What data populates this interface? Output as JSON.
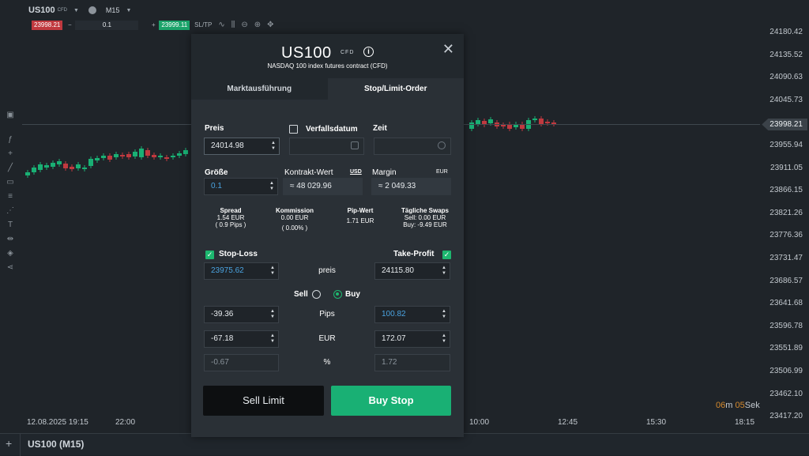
{
  "toolbar": {
    "symbol": "US100",
    "symbol_badge": "CFD",
    "timeframe": "M15",
    "sell_price": "23998.21",
    "quantity": "0.1",
    "buy_price": "23999.11",
    "sltp_label": "SL/TP"
  },
  "y_axis": [
    "24180.42",
    "24135.52",
    "24090.63",
    "24045.73",
    "23955.94",
    "23911.05",
    "23866.15",
    "23821.26",
    "23776.36",
    "23731.47",
    "23686.57",
    "23641.68",
    "23596.78",
    "23551.89",
    "23506.99",
    "23462.10",
    "23417.20"
  ],
  "current_price": "23998.21",
  "x_axis": [
    "12.08.2025 19:15",
    "22:00",
    "10:00",
    "12:45",
    "15:30",
    "18:15"
  ],
  "timer": {
    "minutes": "06",
    "m_unit": "m ",
    "seconds": "05",
    "s_unit": "Sek"
  },
  "bottom_title": "US100 (M15)",
  "colors": {
    "buy": "#19b074",
    "sell": "#c0393f",
    "accent_blue": "#4aa3e0",
    "timer_orange": "#d4892d"
  },
  "modal": {
    "title": "US100",
    "badge": "CFD",
    "subtitle": "NASDAQ 100 index futures contract (CFD)",
    "tabs": [
      {
        "label": "Marktausführung"
      },
      {
        "label": "Stop/Limit-Order"
      }
    ],
    "active_tab": "Stop/Limit-Order",
    "price_label": "Preis",
    "price_value": "24014.98",
    "expiry_label": "Verfallsdatum",
    "time_label": "Zeit",
    "size_label": "Größe",
    "size_value": "0.1",
    "contract_label": "Kontrakt-Wert",
    "contract_currency": "USD",
    "contract_value": "≈ 48 029.96",
    "margin_label": "Margin",
    "margin_currency": "EUR",
    "margin_value": "≈ 2 049.33",
    "info": {
      "spread_label": "Spread",
      "spread_value": "1.54 EUR",
      "spread_pips": "( 0.9 Pips )",
      "commission_label": "Kommission",
      "commission_value": "0.00 EUR",
      "commission_pct": "( 0.00% )",
      "pip_label": "Pip-Wert",
      "pip_value": "1.71 EUR",
      "swaps_label": "Tägliche Swaps",
      "swaps_sell": "Sell: 0.00 EUR",
      "swaps_buy": "Buy: -9.49 EUR"
    },
    "stop_loss_label": "Stop-Loss",
    "take_profit_label": "Take-Profit",
    "row_price_label": "preis",
    "sl_price": "23975.62",
    "tp_price": "24115.80",
    "sell_label": "Sell",
    "buy_label": "Buy",
    "selected_side": "Buy",
    "pips_label": "Pips",
    "sl_pips": "-39.36",
    "tp_pips": "100.82",
    "eur_label": "EUR",
    "sl_eur": "-67.18",
    "tp_eur": "172.07",
    "pct_label": "%",
    "sl_pct": "-0.67",
    "tp_pct": "1.72",
    "sell_button": "Sell Limit",
    "buy_button": "Buy Stop"
  }
}
